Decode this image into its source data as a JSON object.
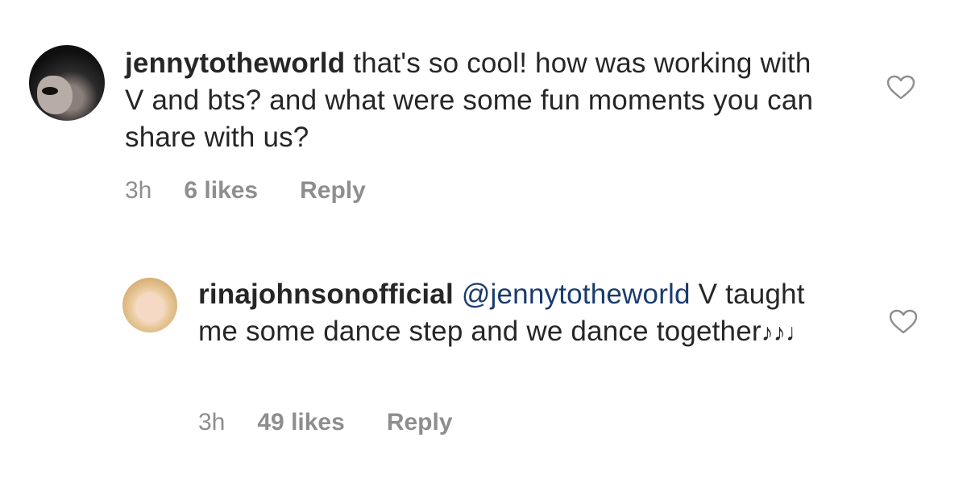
{
  "comments": [
    {
      "username": "jennytotheworld",
      "text": "that's so cool! how was working with V and bts? and what were some fun moments you can share with us?",
      "time": "3h",
      "likes": "6 likes",
      "reply_label": "Reply",
      "like_icon": "heart-outline-icon"
    },
    {
      "username": "rinajohnsonofficial",
      "mention": "@jennytotheworld",
      "text": "V taught me some dance step and we dance together",
      "emoji": "♪♪♩",
      "time": "3h",
      "likes": "49 likes",
      "reply_label": "Reply",
      "like_icon": "heart-outline-icon"
    }
  ],
  "colors": {
    "text": "#262626",
    "meta": "#8e8e8e",
    "mention": "#1a3b6e"
  }
}
